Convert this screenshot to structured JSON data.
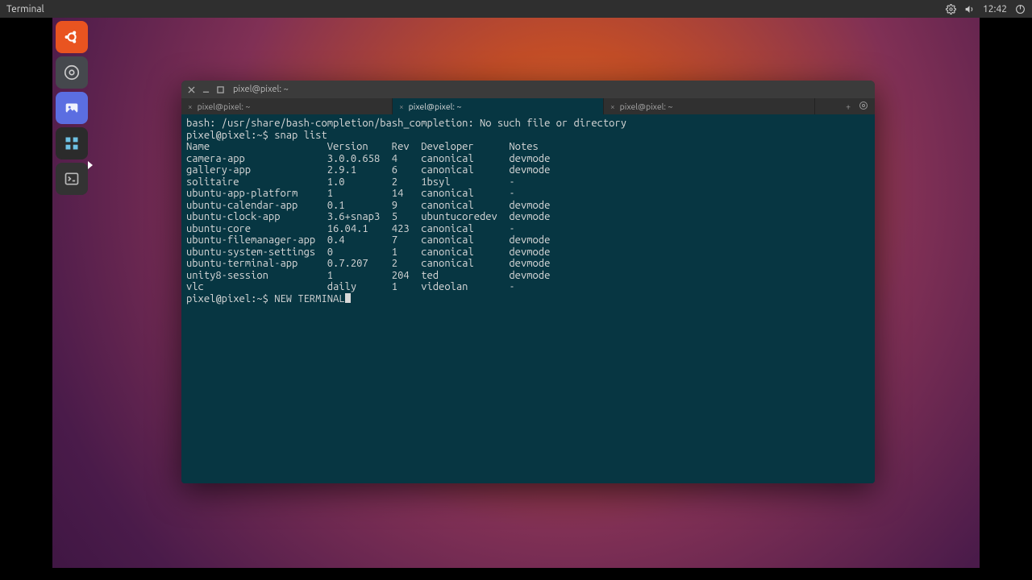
{
  "panel": {
    "app_name": "Terminal",
    "clock": "12:42"
  },
  "launcher": {
    "items": [
      {
        "name": "ubuntu-logo"
      },
      {
        "name": "system-settings"
      },
      {
        "name": "gallery"
      },
      {
        "name": "tiles"
      },
      {
        "name": "terminal"
      }
    ]
  },
  "window": {
    "title": "pixel@pixel: ~",
    "tabs": [
      {
        "label": "pixel@pixel: ~",
        "active": false
      },
      {
        "label": "pixel@pixel: ~",
        "active": true
      },
      {
        "label": "pixel@pixel: ~",
        "active": false
      }
    ]
  },
  "terminal": {
    "error_line": "bash: /usr/share/bash-completion/bash_completion: No such file or directory",
    "prompt1": "pixel@pixel:~$ ",
    "command1": "snap list",
    "columns": [
      "Name",
      "Version",
      "Rev",
      "Developer",
      "Notes"
    ],
    "rows": [
      {
        "name": "camera-app",
        "version": "3.0.0.658",
        "rev": "4",
        "developer": "canonical",
        "notes": "devmode"
      },
      {
        "name": "gallery-app",
        "version": "2.9.1",
        "rev": "6",
        "developer": "canonical",
        "notes": "devmode"
      },
      {
        "name": "solitaire",
        "version": "1.0",
        "rev": "2",
        "developer": "1bsyl",
        "notes": "-"
      },
      {
        "name": "ubuntu-app-platform",
        "version": "1",
        "rev": "14",
        "developer": "canonical",
        "notes": "-"
      },
      {
        "name": "ubuntu-calendar-app",
        "version": "0.1",
        "rev": "9",
        "developer": "canonical",
        "notes": "devmode"
      },
      {
        "name": "ubuntu-clock-app",
        "version": "3.6+snap3",
        "rev": "5",
        "developer": "ubuntucoredev",
        "notes": "devmode"
      },
      {
        "name": "ubuntu-core",
        "version": "16.04.1",
        "rev": "423",
        "developer": "canonical",
        "notes": "-"
      },
      {
        "name": "ubuntu-filemanager-app",
        "version": "0.4",
        "rev": "7",
        "developer": "canonical",
        "notes": "devmode"
      },
      {
        "name": "ubuntu-system-settings",
        "version": "0",
        "rev": "1",
        "developer": "canonical",
        "notes": "devmode"
      },
      {
        "name": "ubuntu-terminal-app",
        "version": "0.7.207",
        "rev": "2",
        "developer": "canonical",
        "notes": "devmode"
      },
      {
        "name": "unity8-session",
        "version": "1",
        "rev": "204",
        "developer": "ted",
        "notes": "devmode"
      },
      {
        "name": "vlc",
        "version": "daily",
        "rev": "1",
        "developer": "videolan",
        "notes": "-"
      }
    ],
    "prompt2": "pixel@pixel:~$ ",
    "command2": "NEW TERMINAL",
    "col_widths": {
      "name": 24,
      "version": 11,
      "rev": 5,
      "developer": 15,
      "notes": 0
    }
  }
}
